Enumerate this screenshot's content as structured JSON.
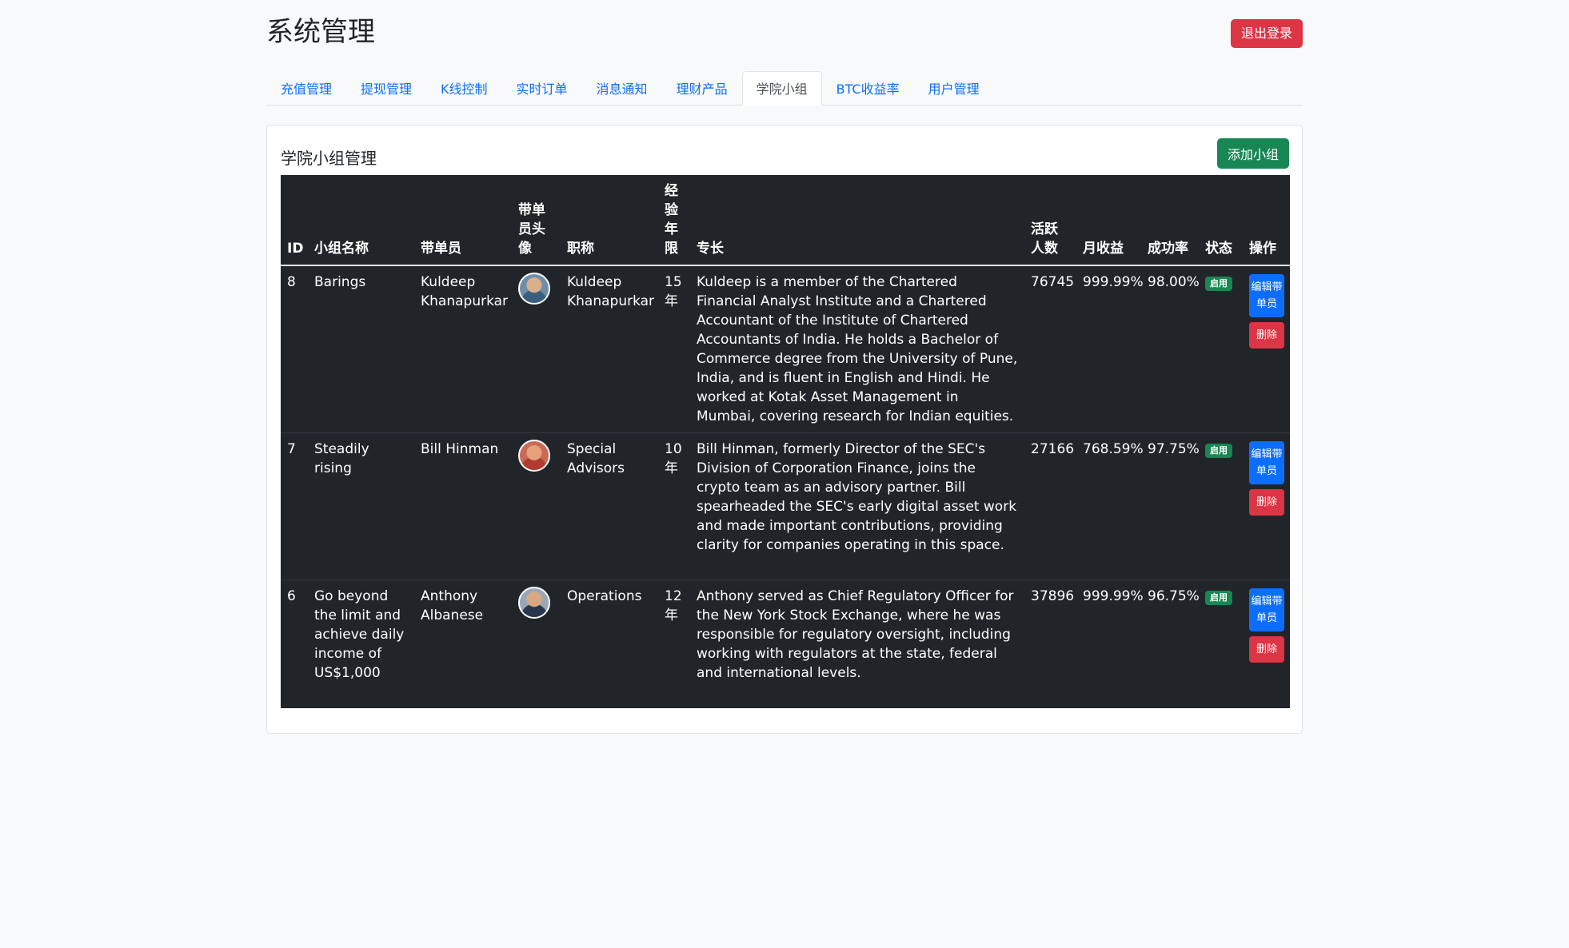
{
  "header": {
    "title": "系统管理",
    "logout_label": "退出登录"
  },
  "tabs": [
    {
      "label": "充值管理"
    },
    {
      "label": "提现管理"
    },
    {
      "label": "K线控制"
    },
    {
      "label": "实时订单"
    },
    {
      "label": "消息通知"
    },
    {
      "label": "理财产品"
    },
    {
      "label": "学院小组",
      "active": true
    },
    {
      "label": "BTC收益率"
    },
    {
      "label": "用户管理"
    }
  ],
  "card": {
    "title": "学院小组管理",
    "add_label": "添加小组"
  },
  "table": {
    "columns": [
      "ID",
      "小组名称",
      "带单员",
      "带单员头像",
      "职称",
      "经验年限",
      "专长",
      "活跃人数",
      "月收益",
      "成功率",
      "状态",
      "操作"
    ],
    "rows": [
      {
        "id": "8",
        "name": "Barings",
        "leader": "Kuldeep Khanapurkar",
        "title": "Kuldeep Khanapurkar",
        "years": "15年",
        "specialty": "Kuldeep is a member of the Chartered Financial Analyst Institute and a Chartered Accountant of the Institute of Chartered Accountants of India. He holds a Bachelor of Commerce degree from the University of Pune, India, and is fluent in English and Hindi. He worked at Kotak Asset Management in Mumbai, covering research for Indian equities.",
        "active": "76745",
        "monthly": "999.99%",
        "success": "98.00%",
        "status": "启用"
      },
      {
        "id": "7",
        "name": "Steadily rising",
        "leader": "Bill Hinman",
        "title": "Special Advisors",
        "years": "10年",
        "specialty": "Bill Hinman, formerly Director of the SEC's Division of Corporation Finance, joins the crypto team as an advisory partner. Bill spearheaded the SEC's early digital asset work and made important contributions, providing clarity for companies operating in this space.",
        "active": "27166",
        "monthly": "768.59%",
        "success": "97.75%",
        "status": "启用"
      },
      {
        "id": "6",
        "name": "Go beyond the limit and achieve daily income of US$1,000",
        "leader": "Anthony Albanese",
        "title": "Operations",
        "years": "12年",
        "specialty": "Anthony served as Chief Regulatory Officer for the New York Stock Exchange, where he was responsible for regulatory oversight, including working with regulators at the state, federal and international levels.",
        "active": "37896",
        "monthly": "999.99%",
        "success": "96.75%",
        "status": "启用"
      }
    ],
    "edit_label": "编辑带单员",
    "delete_label": "删除"
  },
  "colors": {
    "danger": "#dc3545",
    "success": "#198754",
    "primary": "#0d6efd",
    "table_dark": "#212529"
  }
}
